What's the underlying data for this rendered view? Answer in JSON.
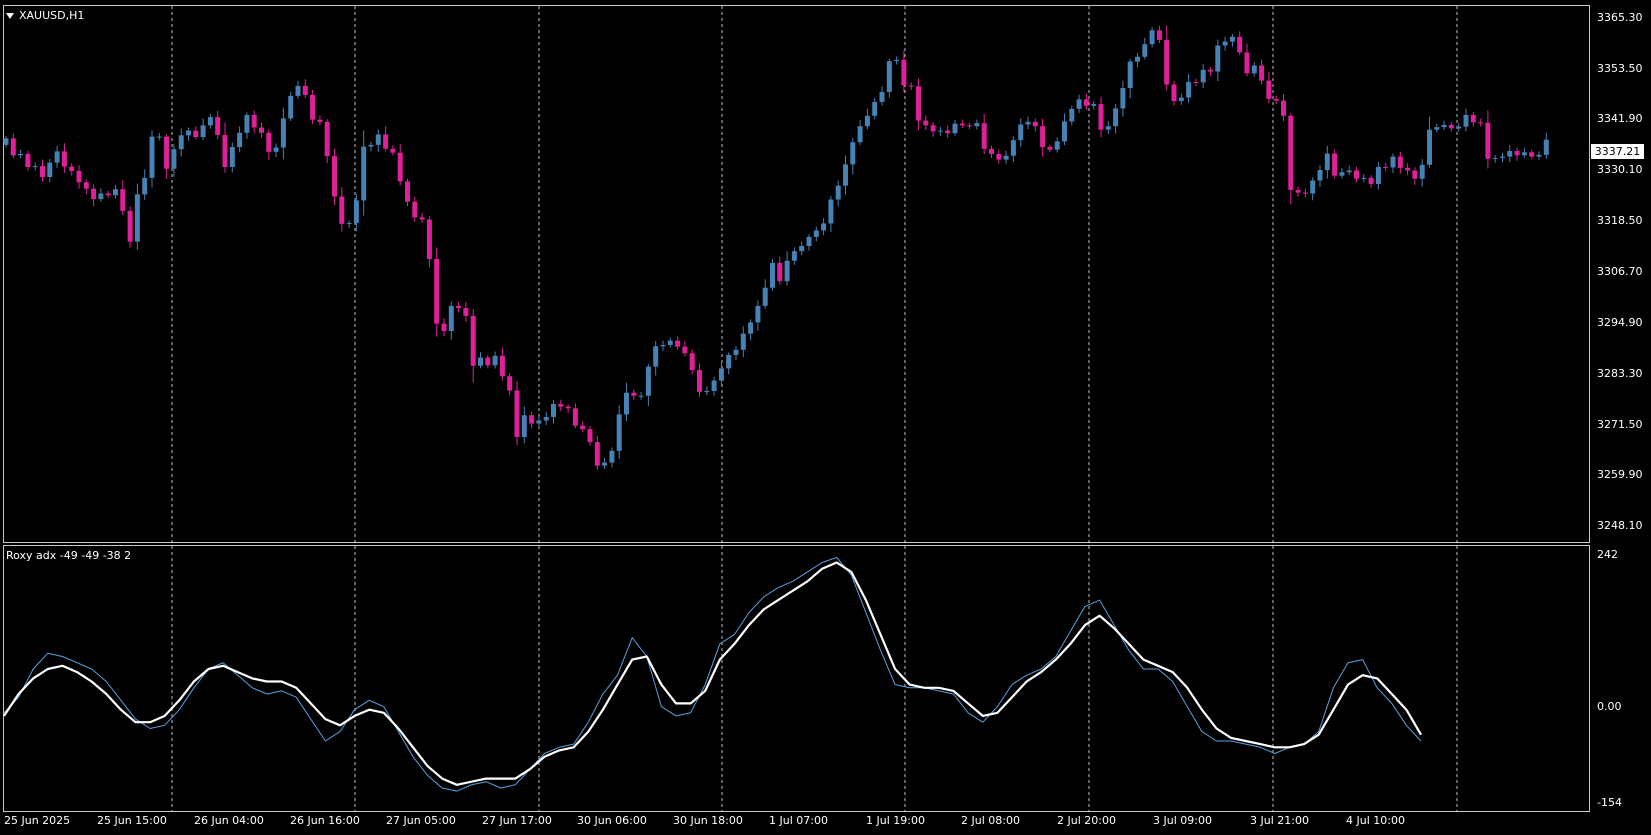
{
  "window": {
    "symbol_label": "XAUUSD,H1",
    "dropdown_icon": "triangle-down-icon"
  },
  "price_axis": {
    "ticks": [
      "3365.30",
      "3353.50",
      "3341.90",
      "3330.10",
      "3318.50",
      "3306.70",
      "3294.90",
      "3283.30",
      "3271.50",
      "3259.90",
      "3248.10"
    ],
    "current_price": "3337.21"
  },
  "indicator": {
    "label": "Roxy adx -49 -49 -38 2",
    "axis_ticks": [
      "242",
      "0.00",
      "-154"
    ]
  },
  "time_axis": {
    "ticks": [
      "25 Jun 2025",
      "25 Jun 15:00",
      "26 Jun 04:00",
      "26 Jun 16:00",
      "27 Jun 05:00",
      "27 Jun 17:00",
      "30 Jun 06:00",
      "30 Jun 18:00",
      "1 Jul 07:00",
      "1 Jul 19:00",
      "2 Jul 08:00",
      "2 Jul 20:00",
      "3 Jul 09:00",
      "3 Jul 21:00",
      "4 Jul 10:00"
    ]
  },
  "colors": {
    "background": "#000000",
    "bull_candle": "#4682b4",
    "bear_candle": "#e0209a",
    "grid": "#ffffff",
    "fast_line": "#5aa0e0",
    "slow_line": "#ffffff"
  },
  "chart_data": {
    "type": "candlestick",
    "title": "XAUUSD,H1",
    "price_range": [
      3244.5,
      3368.0
    ],
    "closes": [
      3337.5,
      3333.6,
      3333.9,
      3330.9,
      3331.1,
      3328.6,
      3331.9,
      3334.5,
      3331.0,
      3330.0,
      3327.4,
      3325.9,
      3323.5,
      3324.8,
      3324.4,
      3325.8,
      3320.8,
      3313.7,
      3324.6,
      3328.4,
      3337.9,
      3337.9,
      3330.5,
      3335.0,
      3338.2,
      3339.3,
      3337.8,
      3340.5,
      3342.4,
      3338.3,
      3330.9,
      3335.5,
      3338.8,
      3342.9,
      3340.0,
      3338.8,
      3334.4,
      3335.4,
      3342.1,
      3347.3,
      3349.6,
      3347.5,
      3341.8,
      3341.3,
      3333.4,
      3324.1,
      3317.8,
      3318.0,
      3323.2,
      3335.6,
      3336.0,
      3338.4,
      3335.1,
      3334.2,
      3327.6,
      3322.9,
      3319.3,
      3318.8,
      3309.7,
      3294.8,
      3293.1,
      3298.9,
      3298.4,
      3296.6,
      3285.1,
      3287.0,
      3285.2,
      3287.4,
      3282.7,
      3279.4,
      3268.7,
      3273.7,
      3271.8,
      3272.5,
      3273.3,
      3276.3,
      3275.7,
      3275.3,
      3271.3,
      3270.5,
      3267.5,
      3262.1,
      3262.8,
      3265.5,
      3273.9,
      3278.9,
      3278.2,
      3278.2,
      3284.9,
      3289.6,
      3289.9,
      3290.9,
      3289.5,
      3288.0,
      3284.1,
      3279.1,
      3279.3,
      3281.7,
      3284.5,
      3287.6,
      3288.8,
      3292.5,
      3295.1,
      3298.9,
      3303.1,
      3308.8,
      3304.6,
      3309.3,
      3311.5,
      3312.7,
      3314.8,
      3316.3,
      3317.9,
      3323.4,
      3326.6,
      3331.5,
      3336.6,
      3340.3,
      3342.7,
      3345.9,
      3348.2,
      3355.3,
      3355.6,
      3349.7,
      3349.5,
      3341.6,
      3340.5,
      3339.1,
      3339.3,
      3338.7,
      3340.9,
      3340.5,
      3340.3,
      3341.0,
      3335.1,
      3333.9,
      3332.6,
      3333.5,
      3337.1,
      3340.7,
      3341.3,
      3340.3,
      3335.5,
      3334.9,
      3336.8,
      3341.4,
      3344.3,
      3346.5,
      3345.0,
      3345.4,
      3339.5,
      3340.3,
      3344.4,
      3349.1,
      3355.2,
      3356.3,
      3359.2,
      3362.4,
      3360.2,
      3349.9,
      3346.1,
      3346.9,
      3350.5,
      3350.4,
      3353.3,
      3352.9,
      3358.9,
      3359.8,
      3360.9,
      3357.3,
      3352.5,
      3354.3,
      3350.8,
      3346.6,
      3346.2,
      3342.7,
      3325.6,
      3325.0,
      3324.8,
      3327.8,
      3330.2,
      3334.0,
      3328.9,
      3329.7,
      3330.1,
      3328.2,
      3328.4,
      3327.0,
      3330.9,
      3330.8,
      3333.3,
      3330.7,
      3330.1,
      3328.2,
      3331.4,
      3339.5,
      3340.1,
      3340.6,
      3339.8,
      3340.2,
      3342.9,
      3341.2,
      3341.1,
      3332.8,
      3333.0,
      3333.3,
      3334.6,
      3333.6,
      3334.3,
      3333.3,
      3333.7,
      3337.2
    ],
    "indicator_series": [
      {
        "name": "fast",
        "values": [
          -10,
          15,
          60,
          85,
          80,
          70,
          60,
          40,
          10,
          -20,
          -35,
          -30,
          -5,
          30,
          60,
          70,
          50,
          30,
          20,
          25,
          15,
          -20,
          -55,
          -40,
          -5,
          10,
          0,
          -40,
          -80,
          -110,
          -130,
          -135,
          -125,
          -120,
          -130,
          -125,
          -100,
          -75,
          -65,
          -60,
          -25,
          20,
          50,
          110,
          80,
          0,
          -15,
          -10,
          35,
          100,
          115,
          150,
          175,
          190,
          200,
          215,
          230,
          238,
          210,
          150,
          90,
          35,
          30,
          30,
          25,
          20,
          -10,
          -25,
          0,
          35,
          50,
          60,
          80,
          120,
          160,
          170,
          130,
          90,
          60,
          60,
          40,
          0,
          -40,
          -55,
          -55,
          -60,
          -65,
          -75,
          -65,
          -60,
          -40,
          30,
          70,
          75,
          30,
          5,
          -30,
          -55
        ]
      },
      {
        "name": "slow",
        "values": [
          -15,
          20,
          45,
          60,
          65,
          55,
          40,
          20,
          -5,
          -25,
          -25,
          -15,
          10,
          40,
          60,
          65,
          55,
          45,
          40,
          40,
          30,
          5,
          -20,
          -30,
          -15,
          -5,
          -10,
          -35,
          -65,
          -95,
          -115,
          -125,
          -120,
          -115,
          -115,
          -115,
          -100,
          -80,
          -70,
          -65,
          -40,
          -5,
          35,
          75,
          80,
          35,
          5,
          5,
          25,
          75,
          100,
          130,
          155,
          170,
          185,
          200,
          220,
          230,
          215,
          170,
          115,
          60,
          35,
          30,
          30,
          25,
          5,
          -15,
          -10,
          15,
          40,
          55,
          75,
          100,
          130,
          145,
          125,
          100,
          75,
          65,
          55,
          30,
          -5,
          -35,
          -50,
          -55,
          -60,
          -65,
          -65,
          -60,
          -45,
          -5,
          35,
          50,
          45,
          20,
          -5,
          -45
        ]
      }
    ],
    "indicator_range": [
      -154,
      242
    ],
    "grid": true,
    "grid_style": "dashed vertical",
    "legend_position": "top-left"
  }
}
